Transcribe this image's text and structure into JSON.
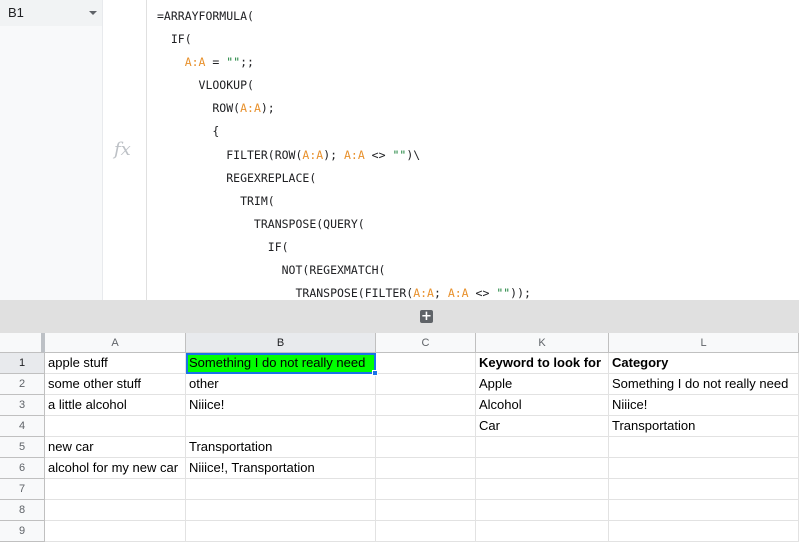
{
  "name_box": {
    "value": "B1"
  },
  "fx_label": "fx",
  "formula_lines": [
    [
      {
        "t": "=ARRAYFORMULA("
      }
    ],
    [
      {
        "t": "  IF("
      }
    ],
    [
      {
        "t": "    "
      },
      {
        "t": "A:A",
        "c": "ref"
      },
      {
        "t": " = "
      },
      {
        "t": "\"\"",
        "c": "str"
      },
      {
        "t": ";;"
      }
    ],
    [
      {
        "t": "      VLOOKUP("
      }
    ],
    [
      {
        "t": "        ROW("
      },
      {
        "t": "A:A",
        "c": "ref"
      },
      {
        "t": ");"
      }
    ],
    [
      {
        "t": "        {"
      }
    ],
    [
      {
        "t": "          FILTER(ROW("
      },
      {
        "t": "A:A",
        "c": "ref"
      },
      {
        "t": "); "
      },
      {
        "t": "A:A",
        "c": "ref"
      },
      {
        "t": " <> "
      },
      {
        "t": "\"\"",
        "c": "str"
      },
      {
        "t": ")\\"
      }
    ],
    [
      {
        "t": "          REGEXREPLACE("
      }
    ],
    [
      {
        "t": "            TRIM("
      }
    ],
    [
      {
        "t": "              TRANSPOSE(QUERY("
      }
    ],
    [
      {
        "t": "                IF("
      }
    ],
    [
      {
        "t": "                  NOT(REGEXMATCH("
      }
    ],
    [
      {
        "t": "                    TRANSPOSE(FILTER("
      },
      {
        "t": "A:A",
        "c": "ref"
      },
      {
        "t": "; "
      },
      {
        "t": "A:A",
        "c": "ref"
      },
      {
        "t": " <> "
      },
      {
        "t": "\"\"",
        "c": "str"
      },
      {
        "t": "));"
      }
    ]
  ],
  "expand_button": "+",
  "columns": [
    "A",
    "B",
    "C",
    "K",
    "L"
  ],
  "selected_column": "B",
  "rows": [
    {
      "num": "1",
      "cells": [
        "apple stuff",
        "Something I do not really need",
        "",
        "Keyword to look for",
        "Category"
      ]
    },
    {
      "num": "2",
      "cells": [
        "some other stuff",
        "other",
        "",
        "Apple",
        "Something I do not really need"
      ]
    },
    {
      "num": "3",
      "cells": [
        "a little alcohol",
        "Niiice!",
        "",
        "Alcohol",
        "Niiice!"
      ]
    },
    {
      "num": "4",
      "cells": [
        "",
        "",
        "",
        "Car",
        "Transportation"
      ]
    },
    {
      "num": "5",
      "cells": [
        "new car",
        "Transportation",
        "",
        "",
        ""
      ]
    },
    {
      "num": "6",
      "cells": [
        "alcohol for my new car",
        "Niiice!, Transportation",
        "",
        "",
        ""
      ]
    },
    {
      "num": "7",
      "cells": [
        "",
        "",
        "",
        "",
        ""
      ]
    },
    {
      "num": "8",
      "cells": [
        "",
        "",
        "",
        "",
        ""
      ]
    },
    {
      "num": "9",
      "cells": [
        "",
        "",
        "",
        "",
        ""
      ]
    }
  ],
  "colors": {
    "active_cell_fill": "#00ff00",
    "selection_border": "#1a73e8",
    "range_ref": "#e8912d",
    "string_literal": "#188038"
  }
}
